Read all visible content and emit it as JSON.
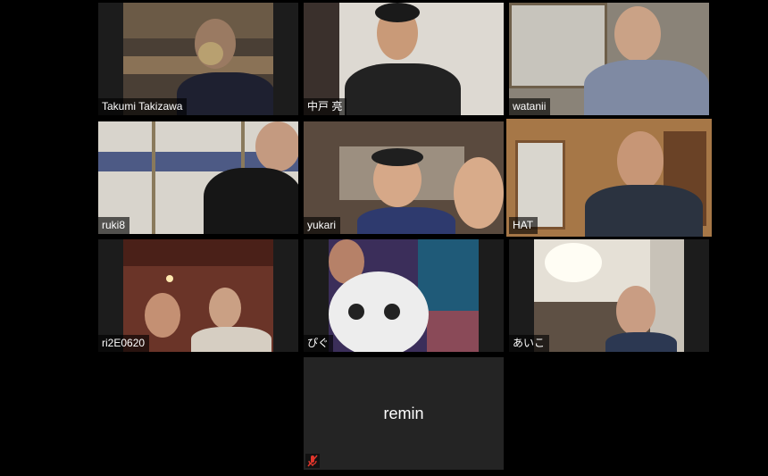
{
  "meeting": {
    "participants": [
      {
        "name": "Takumi Takizawa"
      },
      {
        "name": "中戸 亮"
      },
      {
        "name": "watanii"
      },
      {
        "name": "ruki8"
      },
      {
        "name": "yukari"
      },
      {
        "name": "HAT",
        "active_speaker": true
      },
      {
        "name": "ri2E0620"
      },
      {
        "name": "ぴぐ"
      },
      {
        "name": "あいこ"
      },
      {
        "name": "remin",
        "video_off": true,
        "muted": true
      }
    ]
  },
  "colors": {
    "active_speaker_border": "#e4e46a",
    "muted_icon": "#e0362c",
    "tile_background": "#1c1c1c"
  }
}
